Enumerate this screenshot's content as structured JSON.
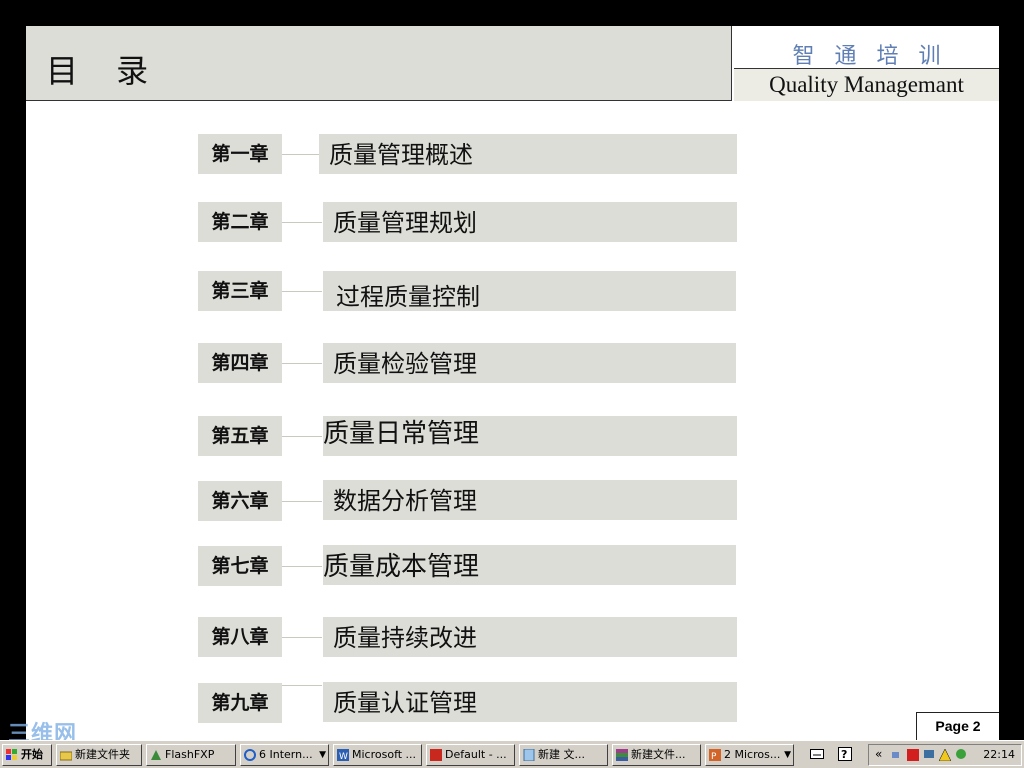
{
  "slide": {
    "title": "目 录",
    "brand_cn": "智通培训",
    "brand_en": "Quality Managemant",
    "page_label": "Page 2",
    "watermark": "三维网"
  },
  "chapters": [
    {
      "label": "第一章",
      "topic": "质量管理概述"
    },
    {
      "label": "第二章",
      "topic": "质量管理规划"
    },
    {
      "label": "第三章",
      "topic": "过程质量控制"
    },
    {
      "label": "第四章",
      "topic": "质量检验管理"
    },
    {
      "label": "第五章",
      "topic": "质量日常管理"
    },
    {
      "label": "第六章",
      "topic": "数据分析管理"
    },
    {
      "label": "第七章",
      "topic": "质量成本管理"
    },
    {
      "label": "第八章",
      "topic": "质量持续改进"
    },
    {
      "label": "第九章",
      "topic": "质量认证管理"
    }
  ],
  "taskbar": {
    "start": "开始",
    "items": [
      {
        "label": "新建文件夹",
        "icon": "folder-icon"
      },
      {
        "label": "FlashFXP",
        "icon": "flashfxp-icon"
      },
      {
        "label": "6 Intern...",
        "icon": "ie-icon"
      },
      {
        "label": "Microsoft ...",
        "icon": "word-icon"
      },
      {
        "label": "Default - ...",
        "icon": "app-icon"
      },
      {
        "label": "新建 文...",
        "icon": "notepad-icon"
      },
      {
        "label": "新建文件...",
        "icon": "winrar-icon"
      },
      {
        "label": "2 Micros...",
        "icon": "powerpoint-icon"
      }
    ],
    "clock": "22:14",
    "colors": {
      "accent": "#5f7fb4",
      "panel": "#ddddd8"
    }
  }
}
